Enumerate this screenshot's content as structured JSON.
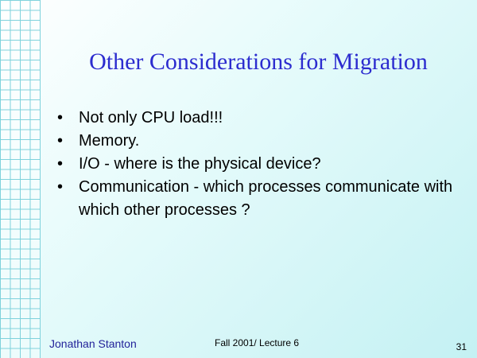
{
  "slide": {
    "title": "Other Considerations for Migration",
    "bullets": [
      "Not only CPU load!!!",
      "Memory.",
      "I/O - where is the physical device?",
      "Communication - which processes communicate with which other processes ?"
    ],
    "bullet_glyph": "•",
    "footer": {
      "author": "Jonathan Stanton",
      "course": "Fall 2001/ Lecture 6",
      "page_number": "31"
    }
  },
  "colors": {
    "title": "#2c2ccf",
    "background": "#e6fbfb",
    "grid_lines": "#7fd2dc"
  }
}
